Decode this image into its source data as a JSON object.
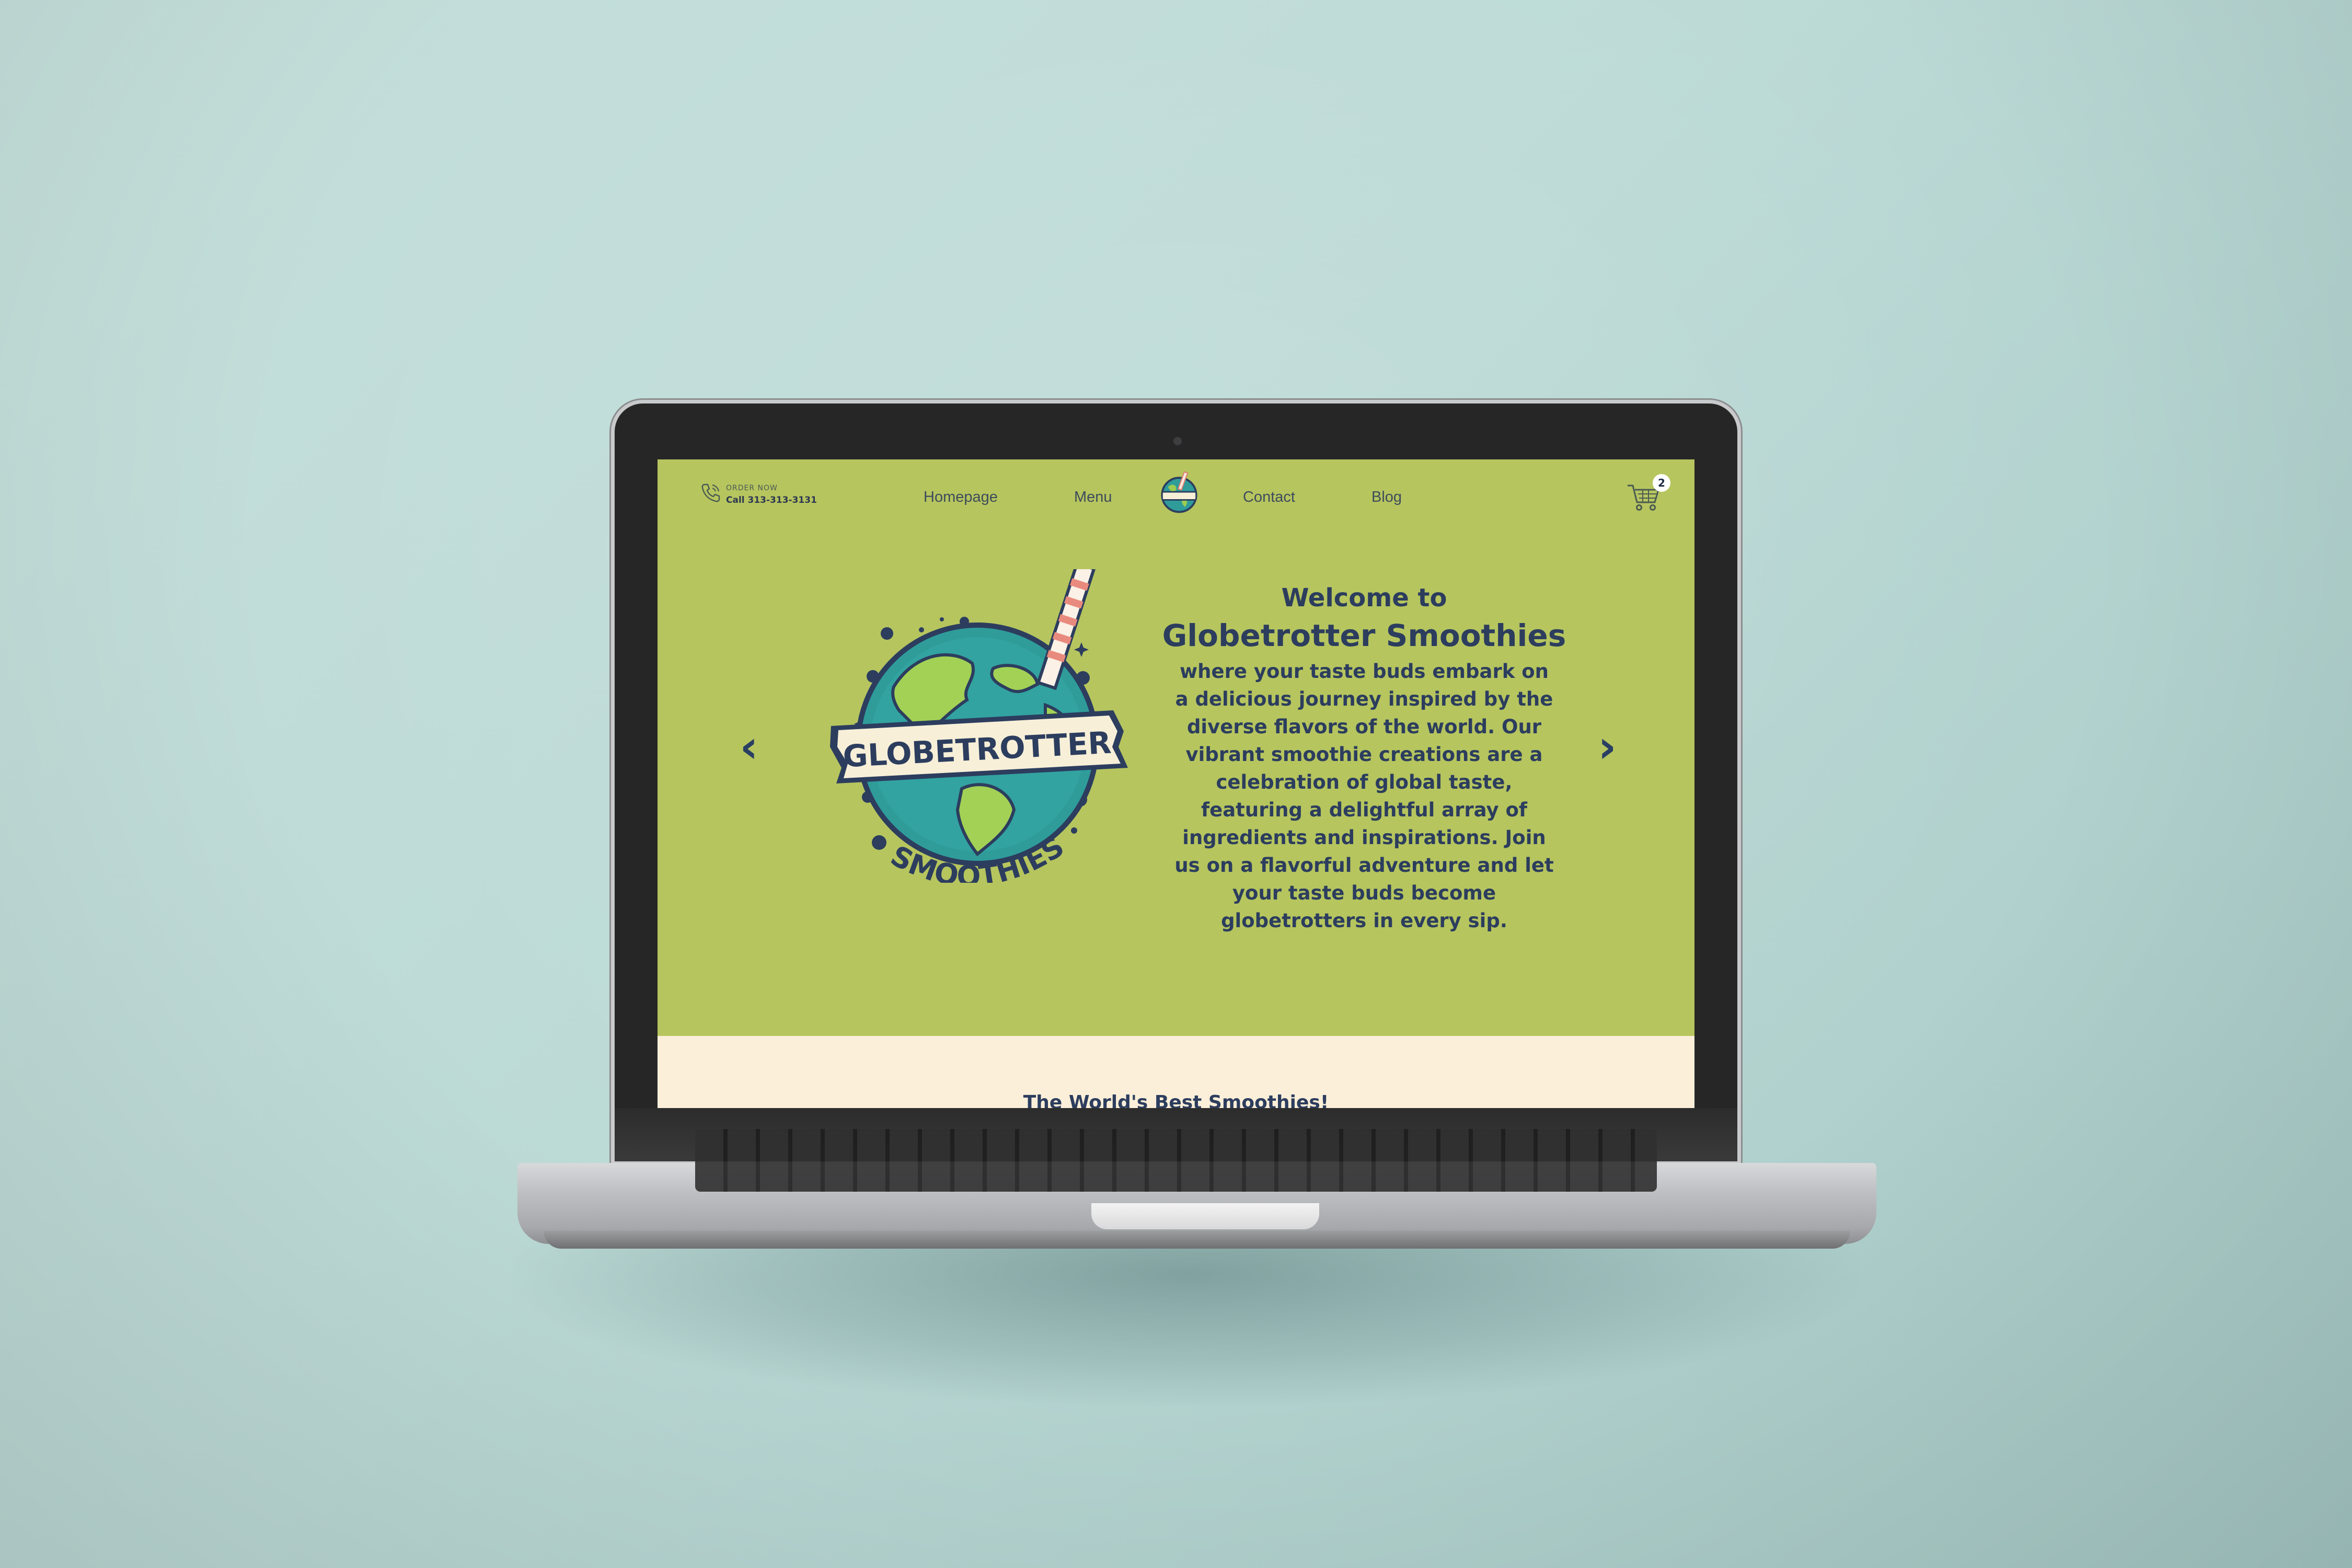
{
  "header": {
    "order_label": "ORDER NOW",
    "order_phone": "Call 313-313-3131",
    "nav": [
      "Homepage",
      "Menu",
      "Contact",
      "Blog"
    ],
    "cart_count": "2"
  },
  "hero": {
    "welcome": "Welcome to",
    "title": "Globetrotter Smoothies",
    "body": "where your taste buds embark on a delicious journey inspired by the diverse flavors of the world. Our vibrant smoothie creations are a celebration of global taste, featuring a delightful array of ingredients and inspirations. Join us on a flavorful adventure and let your taste buds become globetrotters in every sip.",
    "arrow_prev": "‹",
    "arrow_next": "›",
    "logo_text_top": "GLOBETROTTER",
    "logo_text_bottom": "SMOOTHIES"
  },
  "section": {
    "title": "The World's Best Smoothies!"
  },
  "colors": {
    "hero_bg": "#b6c55e",
    "cream_bg": "#fcefd9",
    "navy": "#2c3d5e",
    "backdrop": "#bcdad6"
  },
  "icons": [
    "phone-icon",
    "cart-icon",
    "chevron-left-icon",
    "chevron-right-icon",
    "logo-icon"
  ]
}
